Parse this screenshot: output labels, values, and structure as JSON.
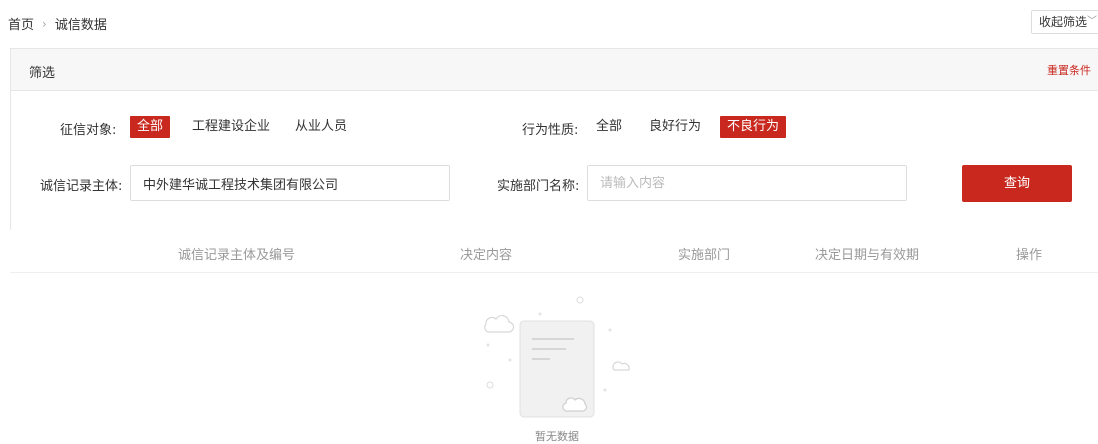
{
  "breadcrumb": {
    "home": "首页",
    "separator": "›",
    "current": "诚信数据"
  },
  "collapse_button": {
    "label": "收起筛选",
    "icon": "chevron-down-icon"
  },
  "filter": {
    "title": "筛选",
    "reset_label": "重置条件",
    "subject_type": {
      "label": "征信对象:",
      "options": [
        "全部",
        "工程建设企业",
        "从业人员"
      ],
      "selected": "全部"
    },
    "behavior_type": {
      "label": "行为性质:",
      "options": [
        "全部",
        "良好行为",
        "不良行为"
      ],
      "selected": "不良行为"
    },
    "subject_field": {
      "label": "诚信记录主体:",
      "value": "中外建华诚工程技术集团有限公司",
      "placeholder": ""
    },
    "department_field": {
      "label": "实施部门名称:",
      "value": "",
      "placeholder": "请输入内容"
    },
    "query_label": "查询"
  },
  "table": {
    "columns": [
      "诚信记录主体及编号",
      "决定内容",
      "实施部门",
      "决定日期与有效期",
      "操作"
    ],
    "rows": []
  },
  "empty_state": {
    "text": "暂无数据",
    "icon": "empty-document-icon"
  },
  "colors": {
    "accent": "#c8281e",
    "muted_text": "#999999",
    "border": "#e6e6e6"
  }
}
